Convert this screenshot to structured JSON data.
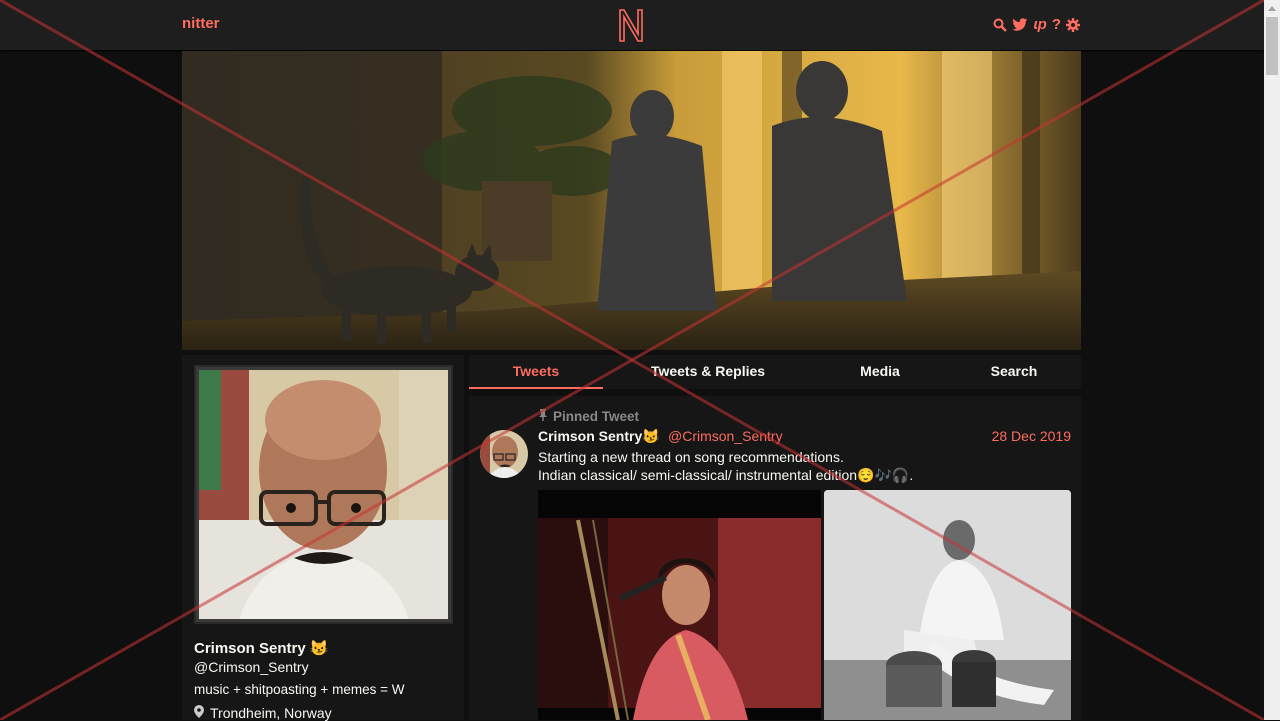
{
  "nav": {
    "brand": "nitter",
    "logo_letter": "N",
    "icons": [
      "search-icon",
      "twitter-icon",
      "rss-icon",
      "help-icon",
      "gear-icon"
    ],
    "rss_glyph": "ɩp",
    "help_glyph": "?"
  },
  "colors": {
    "accent": "#ff6c60",
    "background": "#0f0f0f",
    "panel": "#161616",
    "navbar": "#1e1e1e"
  },
  "profile": {
    "name": "Crimson Sentry",
    "name_emoji": "😼",
    "handle": "@Crimson_Sentry",
    "bio": "music + shitpoasting + memes = W",
    "location": "Trondheim, Norway"
  },
  "tabs": [
    {
      "label": "Tweets",
      "active": true
    },
    {
      "label": "Tweets & Replies",
      "active": false
    },
    {
      "label": "Media",
      "active": false
    },
    {
      "label": "Search",
      "active": false
    }
  ],
  "tweet": {
    "pinned_label": "Pinned Tweet",
    "name": "Crimson Sentry",
    "name_emoji": "😼",
    "handle": "@Crimson_Sentry",
    "date": "28 Dec 2019",
    "line1": "Starting a new thread on song recommendations.",
    "line2": "Indian classical/ semi-classical/ instrumental edition😌🎶🎧."
  }
}
